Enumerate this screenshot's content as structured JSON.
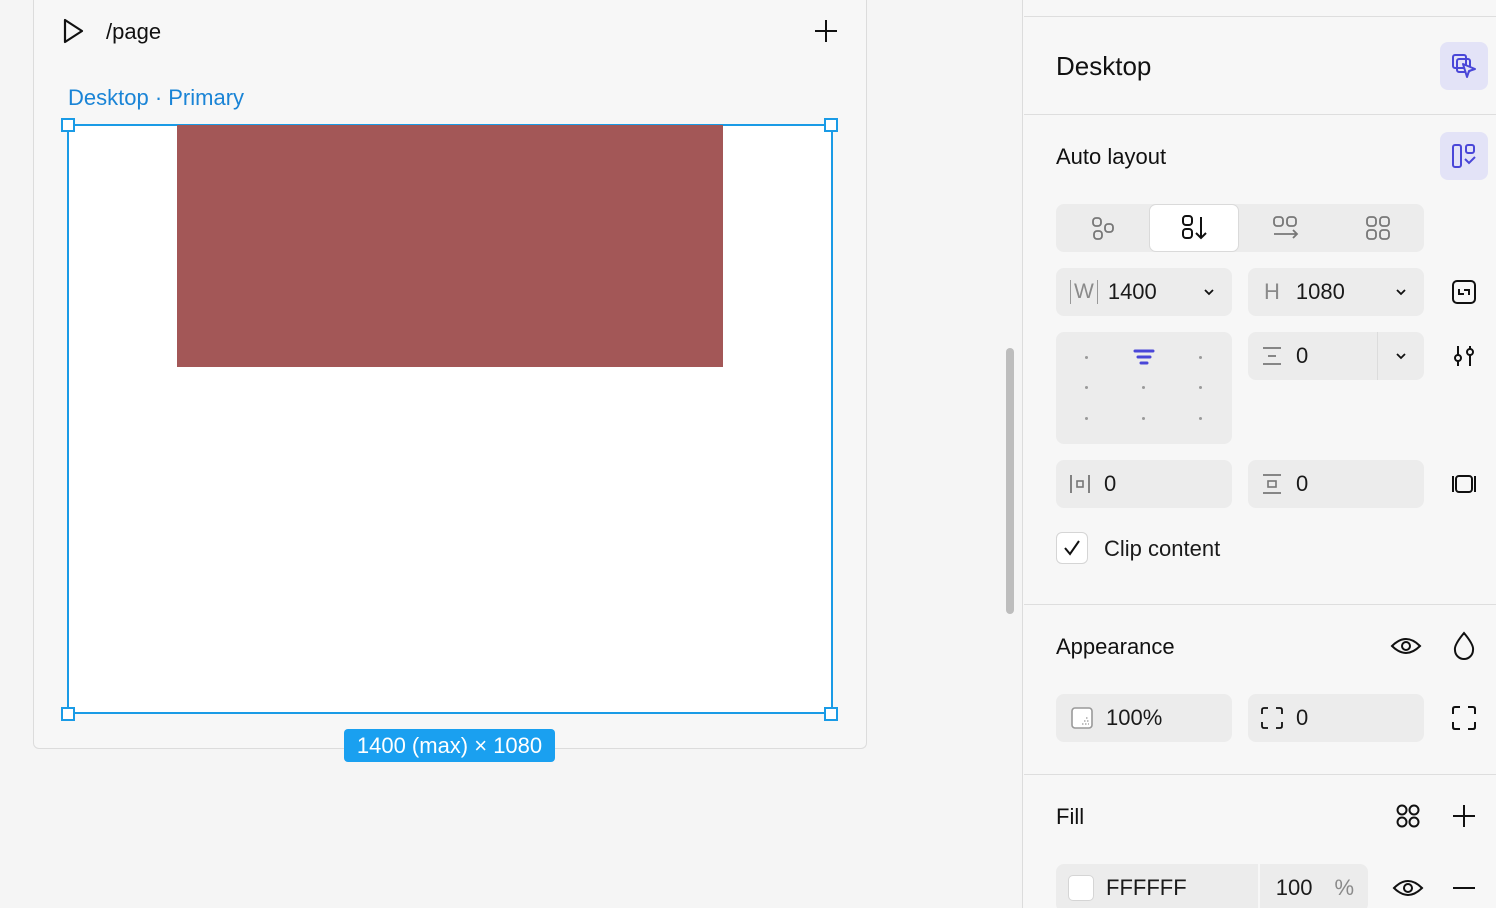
{
  "canvas": {
    "page_path": "/page",
    "frame_label": "Desktop · Primary",
    "size_badge": "1400 (max) × 1080",
    "frame_fill": "#FFFFFF",
    "rect_fill": "#A35757",
    "selection_color": "#1A9BE6"
  },
  "panel": {
    "title": "Desktop",
    "auto_layout": {
      "title": "Auto layout",
      "layout_modes": [
        "free-layout",
        "vertical-stack",
        "horizontal-wrap",
        "grid"
      ],
      "active_mode": "vertical-stack",
      "width_label": "W",
      "width_value": "1400",
      "height_label": "H",
      "height_value": "1080",
      "gap_value": "0",
      "padding_h_value": "0",
      "padding_v_value": "0",
      "clip_content_label": "Clip content",
      "clip_content_checked": true
    },
    "appearance": {
      "title": "Appearance",
      "opacity_value": "100%",
      "radius_value": "0"
    },
    "fill": {
      "title": "Fill",
      "hex_value": "FFFFFF",
      "opacity_value": "100",
      "percent_sign": "%"
    },
    "accent_color": "#4A47D8"
  }
}
